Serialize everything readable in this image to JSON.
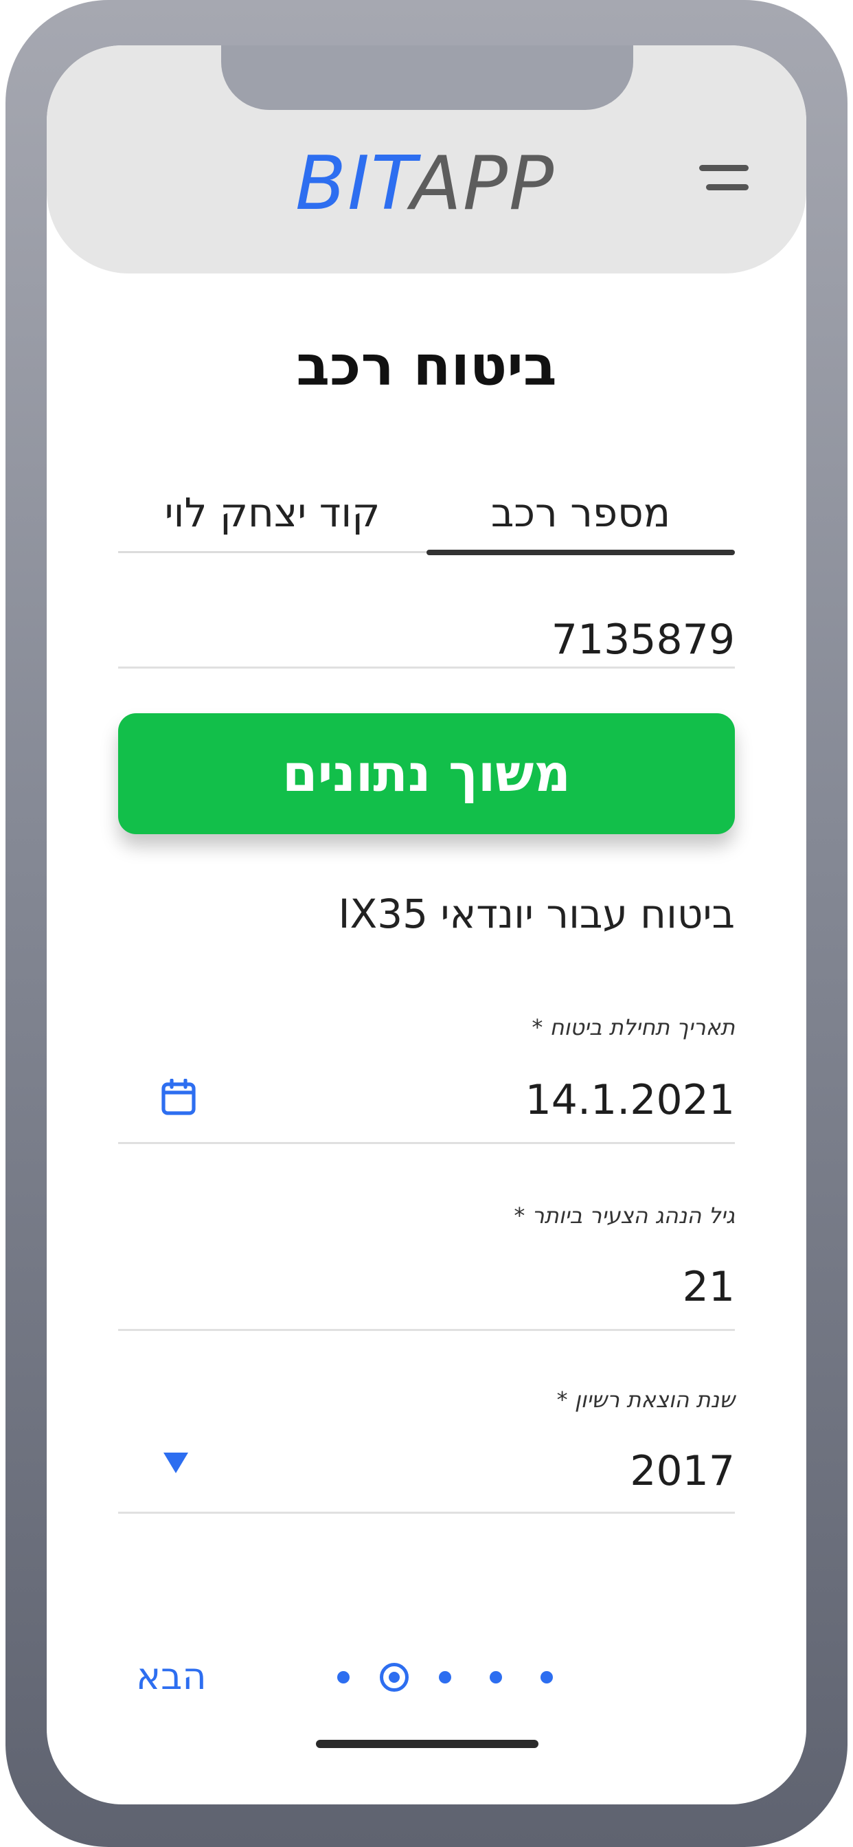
{
  "header": {
    "logo_bit": "BIT",
    "logo_app": "APP",
    "menu_icon": "hamburger-menu-icon"
  },
  "page": {
    "title": "ביטוח רכב"
  },
  "tabs": [
    {
      "label": "מספר רכב",
      "active": true
    },
    {
      "label": "קוד יצחק לוי",
      "active": false
    }
  ],
  "vehicle_number": {
    "value": "7135879"
  },
  "fetch_button": {
    "label": "משוך נתונים",
    "color": "#12bf4a"
  },
  "vehicle_description": "ביטוח עבור יונדאי IX35",
  "fields": {
    "start_date": {
      "label": "תאריך תחילת ביטוח *",
      "value": "14.1.2021",
      "icon": "calendar-icon"
    },
    "youngest_driver_age": {
      "label": "גיל הנהג הצעיר ביותר *",
      "value": "21"
    },
    "license_year": {
      "label": "שנת הוצאת רשיון *",
      "value": "2017",
      "icon": "dropdown-arrow-icon"
    }
  },
  "pagination": {
    "total_steps": 5,
    "current_step": 4
  },
  "footer": {
    "next_label": "הבא"
  },
  "colors": {
    "accent": "#2d6ef0",
    "primary_button": "#12bf4a",
    "device_frame": "#858995"
  }
}
